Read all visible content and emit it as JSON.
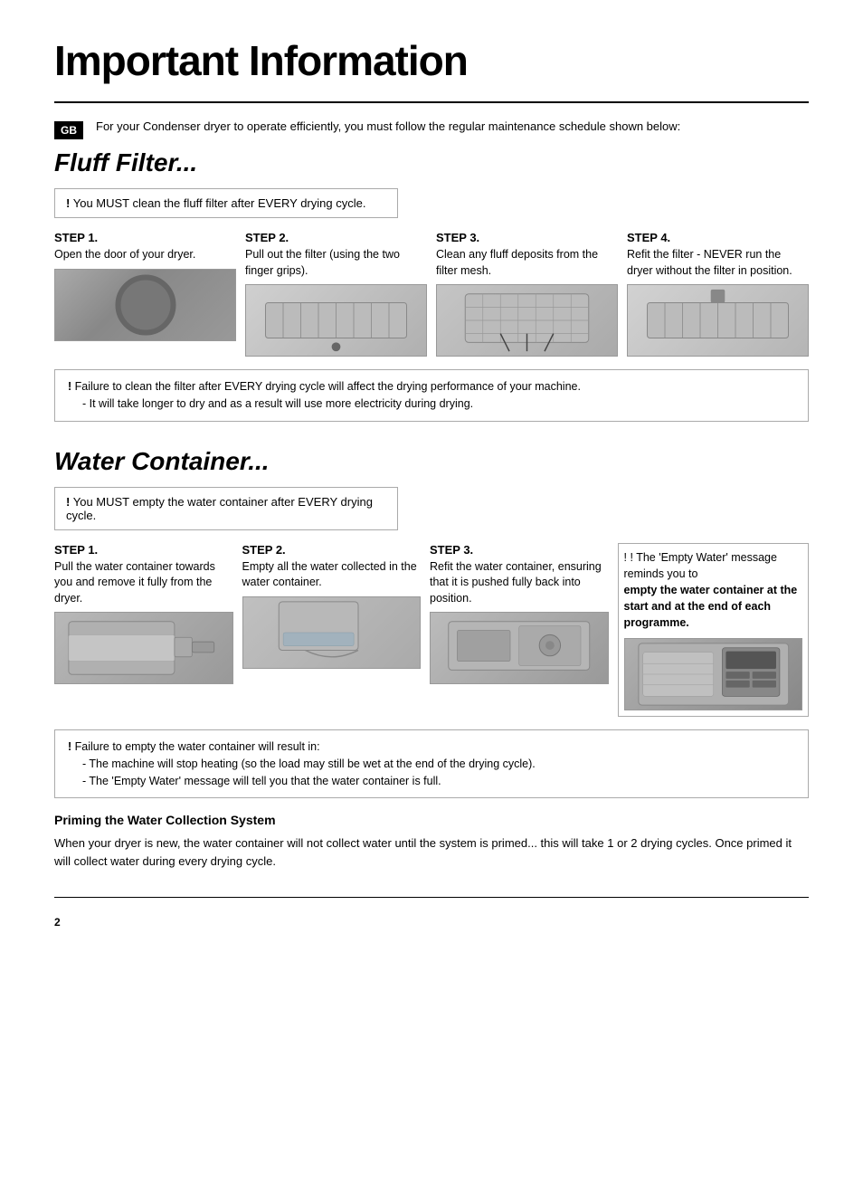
{
  "page": {
    "main_title": "Important Information",
    "gb_label": "GB",
    "intro_text": "For your Condenser dryer to operate efficiently, you must follow the regular maintenance schedule shown below:",
    "page_number": "2"
  },
  "fluff_filter": {
    "section_title": "Fluff Filter...",
    "warning_text": "You MUST clean the fluff filter after EVERY drying cycle.",
    "steps": [
      {
        "label": "STEP 1.",
        "desc": "Open the door of your dryer.",
        "img_type": "dryer-door"
      },
      {
        "label": "STEP 2.",
        "desc": "Pull out the filter (using the two finger grips).",
        "img_type": "filter-pull"
      },
      {
        "label": "STEP 3.",
        "desc": "Clean any fluff deposits from the filter mesh.",
        "img_type": "filter-mesh"
      },
      {
        "label": "STEP 4.",
        "desc": "Refit the filter - NEVER run the dryer without the filter in position.",
        "img_type": "filter-refit"
      }
    ],
    "failure_line1": "Failure to clean the filter after EVERY drying cycle will affect the drying performance of your machine.",
    "failure_line2": "It will take longer to dry and as a result will use more electricity during drying."
  },
  "water_container": {
    "section_title": "Water Container...",
    "warning_text": "You MUST empty the water container after EVERY drying cycle.",
    "steps": [
      {
        "label": "STEP 1.",
        "desc": "Pull the water container towards you and remove it fully from the dryer.",
        "img_type": "water-pull"
      },
      {
        "label": "STEP 2.",
        "desc": "Empty all the water collected in the water container.",
        "img_type": "water-empty"
      },
      {
        "label": "STEP 3.",
        "desc": "Refit the water container, ensuring that it is pushed fully back into position.",
        "img_type": "water-refit"
      },
      {
        "label": "highlight",
        "desc": "",
        "highlight_prefix": "! The 'Empty Water' message reminds you to",
        "highlight_bold": "empty the water container at the start and at the end of each programme.",
        "img_type": "display-panel"
      }
    ],
    "failure_line1": "Failure to empty the water container will result in:",
    "failure_bullets": [
      "The machine will stop heating (so the load may still be wet at the end of the drying cycle).",
      "The 'Empty Water' message will tell you that the water container is full."
    ]
  },
  "priming": {
    "title": "Priming the Water Collection System",
    "text": "When your dryer is new, the water container will not collect water until the system is primed... this will take 1 or 2 drying cycles. Once primed it will collect water during every drying cycle."
  }
}
